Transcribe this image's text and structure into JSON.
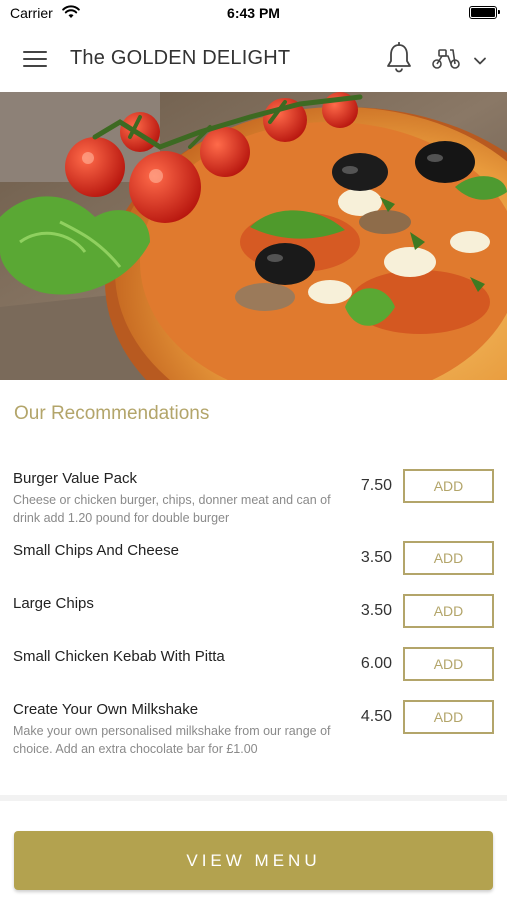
{
  "status_bar": {
    "carrier": "Carrier",
    "time": "6:43 PM"
  },
  "header": {
    "title": "The GOLDEN DELIGHT",
    "icons": [
      "menu-icon",
      "bell-icon",
      "scooter-icon",
      "chevron-down-icon"
    ]
  },
  "hero": {
    "image": "pizza-photo"
  },
  "recommendations": {
    "title": "Our Recommendations",
    "add_label": "ADD",
    "items": [
      {
        "name": "Burger Value Pack",
        "description": "Cheese or chicken burger, chips, donner meat and can of drink add 1.20 pound for double burger",
        "price": "7.50"
      },
      {
        "name": "Small Chips And Cheese",
        "description": "",
        "price": "3.50"
      },
      {
        "name": "Large Chips",
        "description": "",
        "price": "3.50"
      },
      {
        "name": "Small Chicken Kebab With Pitta",
        "description": "",
        "price": "6.00"
      },
      {
        "name": "Create Your Own Milkshake",
        "description": "Make your own personalised milkshake from our range of choice. Add an extra chocolate bar for £1.00",
        "price": "4.50"
      }
    ]
  },
  "footer": {
    "view_menu_label": "VIEW MENU"
  },
  "colors": {
    "accent": "#b3a56a",
    "button": "#b3a24f"
  }
}
